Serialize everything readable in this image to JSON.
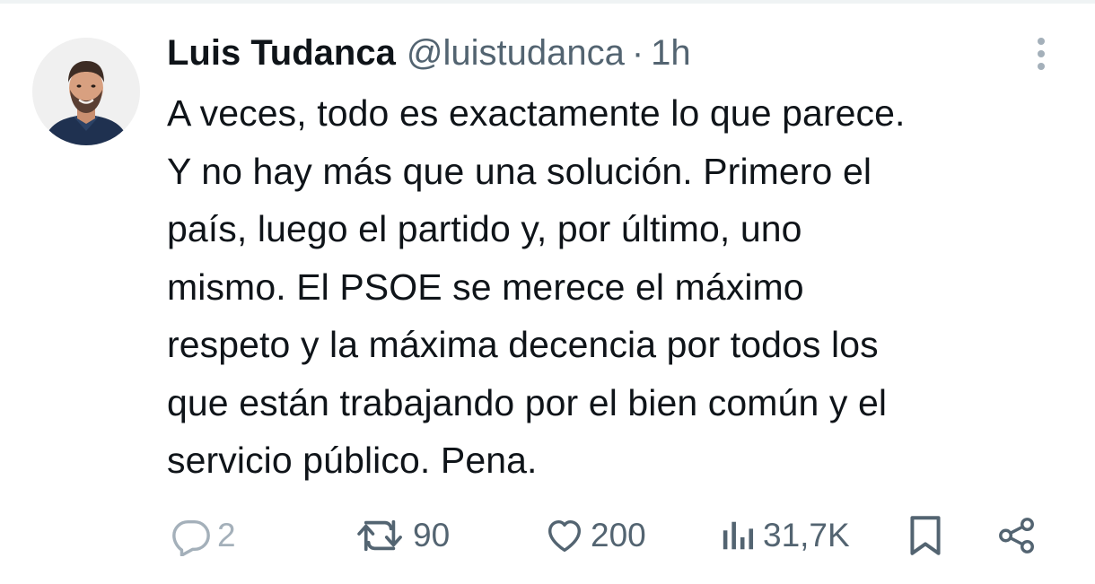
{
  "tweet": {
    "author": {
      "display_name": "Luis Tudanca",
      "handle": "@luistudanca"
    },
    "separator": "·",
    "time": "1h",
    "text": "A veces, todo es exactamente lo que parece.\nY no hay más que una solución. Primero el\npaís, luego el partido y, por último, uno\nmismo. El PSOE se merece el máximo\nrespeto y la máxima decencia por todos los\nque están trabajando por el bien común y el\nservicio público. Pena.",
    "actions": {
      "replies": "2",
      "retweets": "90",
      "likes": "200",
      "views": "31,7K"
    },
    "icons": {
      "more": "more-vertical-icon",
      "reply": "reply-icon",
      "retweet": "retweet-icon",
      "like": "heart-icon",
      "views": "views-icon",
      "bookmark": "bookmark-icon",
      "share": "share-icon"
    },
    "colors": {
      "text": "#0f1419",
      "secondary": "#536471",
      "muted": "#a4b0ba",
      "divider": "#eff3f4"
    }
  }
}
